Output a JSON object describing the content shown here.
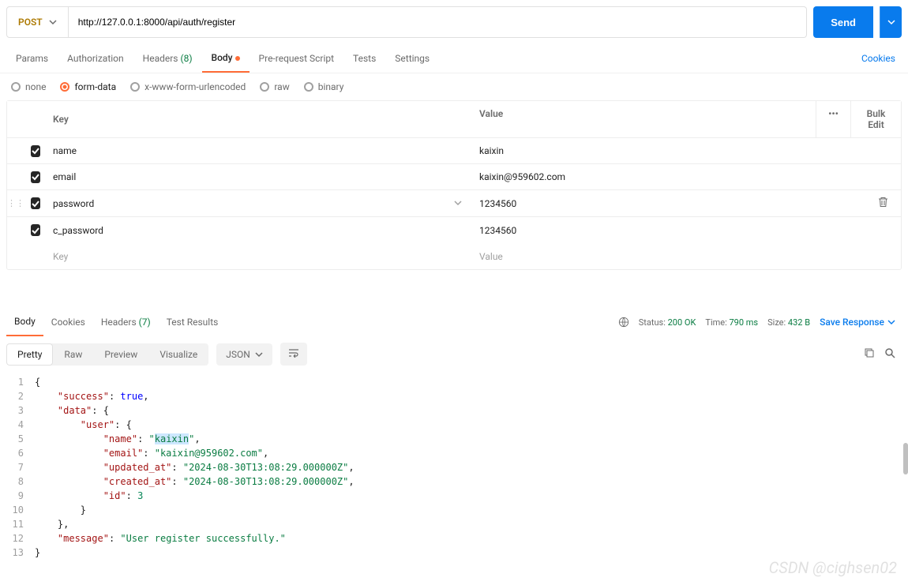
{
  "request": {
    "method": "POST",
    "url": "http://127.0.0.1:8000/api/auth/register",
    "send_label": "Send"
  },
  "tabs": {
    "params": "Params",
    "auth": "Authorization",
    "headers": "Headers",
    "headers_count": "(8)",
    "body": "Body",
    "prerequest": "Pre-request Script",
    "tests": "Tests",
    "settings": "Settings",
    "cookies": "Cookies"
  },
  "body_types": {
    "none": "none",
    "formdata": "form-data",
    "xwww": "x-www-form-urlencoded",
    "raw": "raw",
    "binary": "binary"
  },
  "kv": {
    "key_header": "Key",
    "value_header": "Value",
    "key_placeholder": "Key",
    "value_placeholder": "Value",
    "options": "•••",
    "bulk_edit": "Bulk Edit",
    "rows": [
      {
        "key": "name",
        "value": "kaixin"
      },
      {
        "key": "email",
        "value": "kaixin@959602.com"
      },
      {
        "key": "password",
        "value": "1234560",
        "focused": true
      },
      {
        "key": "c_password",
        "value": "1234560"
      }
    ]
  },
  "response": {
    "tabs": {
      "body": "Body",
      "cookies": "Cookies",
      "headers": "Headers",
      "headers_count": "(7)",
      "tests": "Test Results"
    },
    "status_label": "Status:",
    "status_value": "200 OK",
    "time_label": "Time:",
    "time_value": "790 ms",
    "size_label": "Size:",
    "size_value": "432 B",
    "save": "Save Response",
    "views": {
      "pretty": "Pretty",
      "raw": "Raw",
      "preview": "Preview",
      "visualize": "Visualize",
      "lang": "JSON"
    },
    "json": {
      "success": true,
      "data": {
        "user": {
          "name": "kaixin",
          "email": "kaixin@959602.com",
          "updated_at": "2024-08-30T13:08:29.000000Z",
          "created_at": "2024-08-30T13:08:29.000000Z",
          "id": 3
        }
      },
      "message": "User register successfully."
    }
  },
  "watermark": "CSDN @cighsen02"
}
